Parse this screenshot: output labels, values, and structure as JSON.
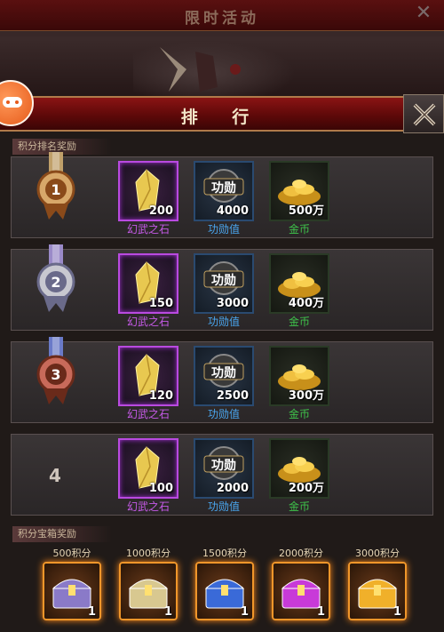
{
  "background_window": {
    "title": "限时活动"
  },
  "panel": {
    "title": "排 行"
  },
  "sections": {
    "rank_rewards": "积分排名奖励",
    "chest_rewards": "积分宝箱奖励"
  },
  "item_names": {
    "stone": "幻武之石",
    "merit": "功勋值",
    "gold": "金币",
    "merit_badge": "功勋"
  },
  "ranks": [
    {
      "rank": "1",
      "medal": "gold-medal-icon",
      "stone": "200",
      "merit": "4000",
      "gold": "500万"
    },
    {
      "rank": "2",
      "medal": "silver-medal-icon",
      "stone": "150",
      "merit": "3000",
      "gold": "400万"
    },
    {
      "rank": "3",
      "medal": "bronze-medal-icon",
      "stone": "120",
      "merit": "2500",
      "gold": "300万"
    },
    {
      "rank": "4",
      "medal": null,
      "stone": "100",
      "merit": "2000",
      "gold": "200万"
    }
  ],
  "chests": [
    {
      "req": "500积分",
      "count": "1",
      "color": "#8a7ac8"
    },
    {
      "req": "1000积分",
      "count": "1",
      "color": "#d8c890"
    },
    {
      "req": "1500积分",
      "count": "1",
      "color": "#3a6ad8"
    },
    {
      "req": "2000积分",
      "count": "1",
      "color": "#c83ad8"
    },
    {
      "req": "3000积分",
      "count": "1",
      "color": "#f0b02a"
    }
  ],
  "colors": {
    "accent_red": "#8a1414",
    "purple_frame": "#b94ae0",
    "blue_text": "#4aa6ef",
    "green_text": "#3ec24a"
  }
}
